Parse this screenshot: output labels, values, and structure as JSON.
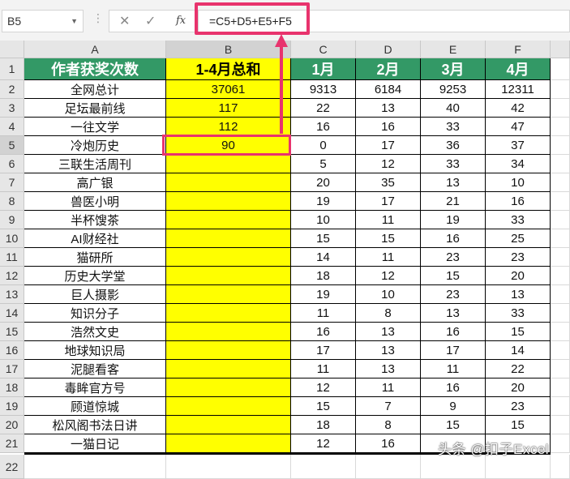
{
  "formula_bar": {
    "name_box": "B5",
    "cancel_icon": "✕",
    "enter_icon": "✓",
    "fx_label": "fx",
    "formula": "=C5+D5+E5+F5"
  },
  "columns": [
    "A",
    "B",
    "C",
    "D",
    "E",
    "F"
  ],
  "header_row": [
    "作者获奖次数",
    "1-4月总和",
    "1月",
    "2月",
    "3月",
    "4月"
  ],
  "rows": [
    [
      "全网总计",
      "37061",
      "9313",
      "6184",
      "9253",
      "12311"
    ],
    [
      "足坛最前线",
      "117",
      "22",
      "13",
      "40",
      "42"
    ],
    [
      "一往文学",
      "112",
      "16",
      "16",
      "33",
      "47"
    ],
    [
      "冷炮历史",
      "90",
      "0",
      "17",
      "36",
      "37"
    ],
    [
      "三联生活周刊",
      "",
      "5",
      "12",
      "33",
      "34"
    ],
    [
      "高广银",
      "",
      "20",
      "35",
      "13",
      "10"
    ],
    [
      "兽医小明",
      "",
      "19",
      "17",
      "21",
      "16"
    ],
    [
      "半杯馊茶",
      "",
      "10",
      "11",
      "19",
      "33"
    ],
    [
      "AI财经社",
      "",
      "15",
      "15",
      "16",
      "25"
    ],
    [
      "猫研所",
      "",
      "14",
      "11",
      "23",
      "23"
    ],
    [
      "历史大学堂",
      "",
      "18",
      "12",
      "15",
      "20"
    ],
    [
      "巨人摄影",
      "",
      "19",
      "10",
      "23",
      "13"
    ],
    [
      "知识分子",
      "",
      "11",
      "8",
      "13",
      "33"
    ],
    [
      "浩然文史",
      "",
      "16",
      "13",
      "16",
      "15"
    ],
    [
      "地球知识局",
      "",
      "17",
      "13",
      "17",
      "14"
    ],
    [
      "泥腿看客",
      "",
      "11",
      "13",
      "11",
      "22"
    ],
    [
      "毒眸官方号",
      "",
      "12",
      "11",
      "16",
      "20"
    ],
    [
      "顾道惊城",
      "",
      "15",
      "7",
      "9",
      "23"
    ],
    [
      "松风阁书法日讲",
      "",
      "18",
      "8",
      "15",
      "15"
    ],
    [
      "一猫日记",
      "",
      "12",
      "16",
      "",
      ""
    ]
  ],
  "extra_row_number": "22",
  "watermark": "头条 @扣子Excel",
  "colors": {
    "header_green": "#339966",
    "highlight_yellow": "#ffff00",
    "annotation_pink": "#e8336d"
  }
}
